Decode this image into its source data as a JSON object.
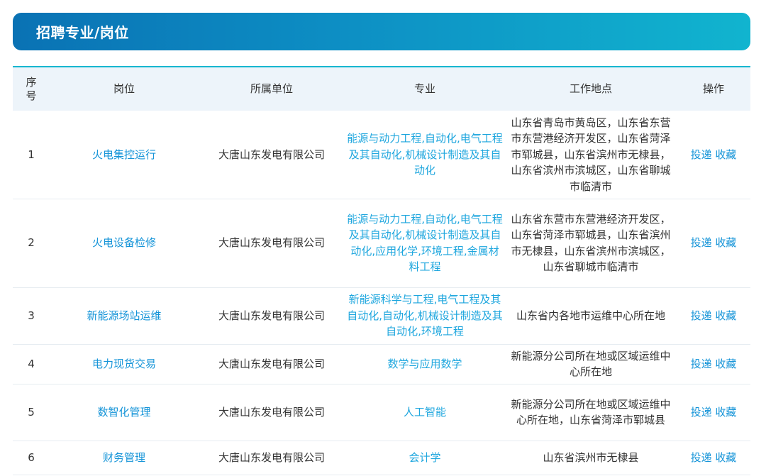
{
  "header": {
    "title": "招聘专业/岗位"
  },
  "table": {
    "columns": {
      "seq_line1": "序",
      "seq_line2": "号",
      "position": "岗位",
      "unit": "所属单位",
      "major": "专业",
      "location": "工作地点",
      "action": "操作"
    },
    "rows": [
      {
        "seq": "1",
        "position": "火电集控运行",
        "unit": "大唐山东发电有限公司",
        "major": "能源与动力工程,自动化,电气工程及其自动化,机械设计制造及其自动化",
        "location": "山东省青岛市黄岛区，山东省东营市东营港经济开发区，山东省菏泽市郓城县，山东省滨州市无棣县，山东省滨州市滨城区，山东省聊城市临清市",
        "apply": "投递",
        "favorite": "收藏"
      },
      {
        "seq": "2",
        "position": "火电设备检修",
        "unit": "大唐山东发电有限公司",
        "major": "能源与动力工程,自动化,电气工程及其自动化,机械设计制造及其自动化,应用化学,环境工程,金属材料工程",
        "location": "山东省东营市东营港经济开发区，山东省菏泽市郓城县，山东省滨州市无棣县，山东省滨州市滨城区，山东省聊城市临清市",
        "apply": "投递",
        "favorite": "收藏"
      },
      {
        "seq": "3",
        "position": "新能源场站运维",
        "unit": "大唐山东发电有限公司",
        "major": "新能源科学与工程,电气工程及其自动化,自动化,机械设计制造及其自动化,环境工程",
        "location": "山东省内各地市运维中心所在地",
        "apply": "投递",
        "favorite": "收藏"
      },
      {
        "seq": "4",
        "position": "电力现货交易",
        "unit": "大唐山东发电有限公司",
        "major": "数学与应用数学",
        "location": "新能源分公司所在地或区域运维中心所在地",
        "apply": "投递",
        "favorite": "收藏"
      },
      {
        "seq": "5",
        "position": "数智化管理",
        "unit": "大唐山东发电有限公司",
        "major": "人工智能",
        "location": "新能源分公司所在地或区域运维中心所在地，山东省菏泽市郓城县",
        "apply": "投递",
        "favorite": "收藏"
      },
      {
        "seq": "6",
        "position": "财务管理",
        "unit": "大唐山东发电有限公司",
        "major": "会计学",
        "location": "山东省滨州市无棣县",
        "apply": "投递",
        "favorite": "收藏"
      }
    ]
  }
}
